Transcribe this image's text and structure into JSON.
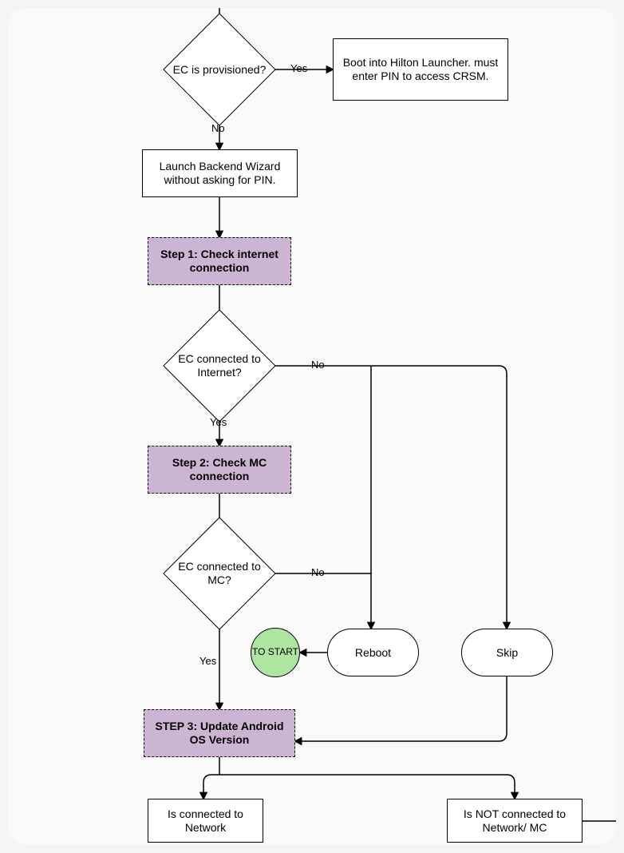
{
  "diagram": {
    "decisions": {
      "ec_provisioned": "EC is provisioned?",
      "ec_internet": "EC connected to Internet?",
      "ec_mc": "EC connected to MC?"
    },
    "processes": {
      "boot_hilton": "Boot into Hilton Launcher. must enter PIN to access CRSM.",
      "launch_wizard": "Launch Backend Wizard without asking for PIN.",
      "connected_network": "Is connected to Network",
      "not_connected_network": "Is NOT connected to Network/ MC"
    },
    "steps": {
      "step1": "Step 1: Check internet connection",
      "step2": "Step 2: Check MC connection",
      "step3": "STEP 3: Update Android OS Version"
    },
    "terminals": {
      "reboot": "Reboot",
      "skip": "Skip",
      "to_start": "TO START"
    },
    "labels": {
      "yes": "Yes",
      "no": "No"
    },
    "colors": {
      "step_fill": "#ccb5d2",
      "circle_fill": "#aee5a1",
      "canvas_bg": "#fafafa",
      "page_bg": "#f5f5f5",
      "stroke": "#000000"
    }
  }
}
